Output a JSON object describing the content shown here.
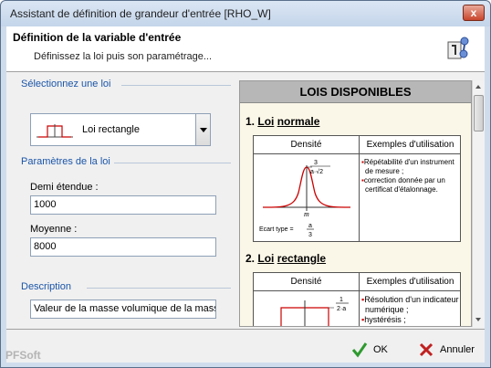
{
  "window": {
    "title": "Assistant de définition de grandeur d'entrée [RHO_W]",
    "close_label": "x"
  },
  "header": {
    "title": "Définition de la variable d'entrée",
    "subtitle": "Définissez la loi puis son paramétrage..."
  },
  "left": {
    "select_section": "Sélectionnez une loi",
    "selected_law": "Loi rectangle",
    "params_section": "Paramètres de la loi",
    "fields": [
      {
        "label": "Demi étendue :",
        "value": "1000"
      },
      {
        "label": "Moyenne :",
        "value": "8000"
      }
    ],
    "description_section": "Description",
    "description_value": "Valeur de la masse volumique de la masse"
  },
  "laws_panel": {
    "header": "LOIS DISPONIBLES",
    "col_density": "Densité",
    "col_examples": "Exemples d'utilisation",
    "laws": [
      {
        "number": "1.",
        "word": "Loi",
        "name": "normale",
        "examples": [
          "Répétabilité d'un instrument de mesure ;",
          "correction donnée par un certificat d'étalonnage."
        ],
        "formula_num": "3",
        "formula_den": "a·√2",
        "axis_label": "m",
        "std_label": "Ecart type =",
        "std_num": "a",
        "std_den": "3"
      },
      {
        "number": "2.",
        "word": "Loi",
        "name": "rectangle",
        "examples": [
          "Résolution d'un indicateur numérique ;",
          "hystérésis ;"
        ],
        "formula_num": "1",
        "formula_den": "2·a"
      }
    ]
  },
  "footer": {
    "brand": "PFSoft",
    "ok_label": "OK",
    "cancel_label": "Annuler"
  },
  "colors": {
    "accent_text": "#1a55a8",
    "curve": "#cc0000",
    "panel_bg": "#fbf7e8"
  }
}
